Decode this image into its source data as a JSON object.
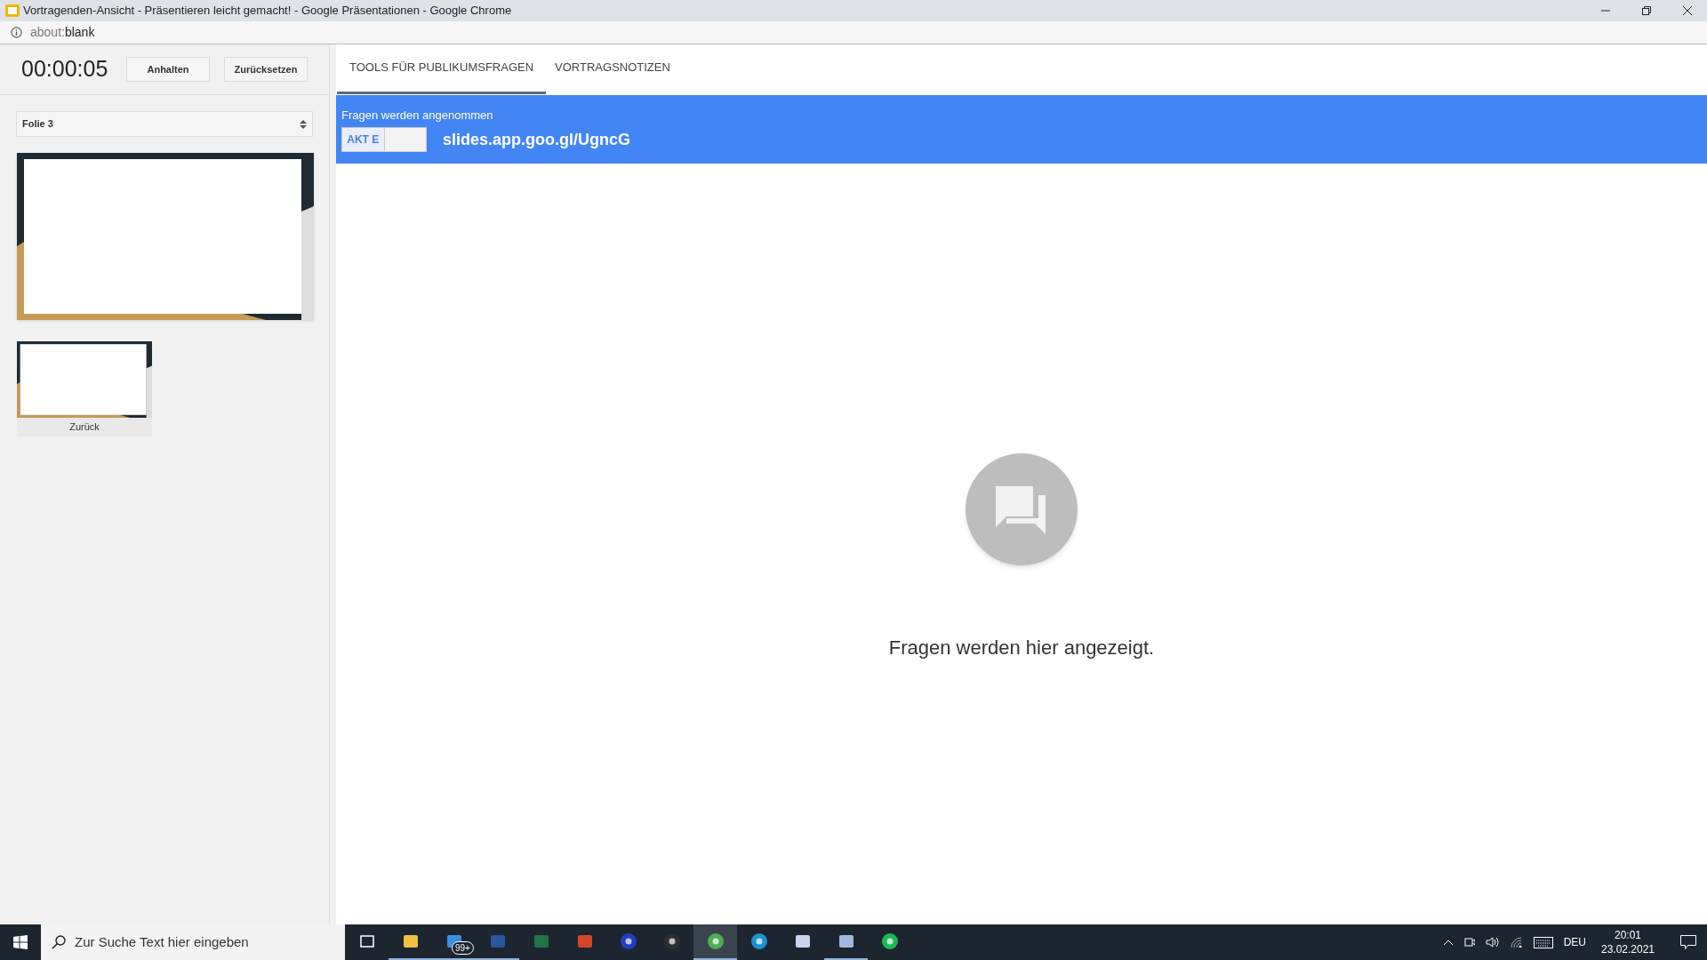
{
  "window": {
    "title": "Vortragenden-Ansicht - Präsentieren leicht gemacht! - Google Präsentationen - Google Chrome"
  },
  "address_bar": {
    "url_prefix": "about:",
    "url_rest": "blank"
  },
  "timer": {
    "time": "00:00:05",
    "buttons": [
      "Anhalten",
      "Zurücksetzen"
    ]
  },
  "slide_select": {
    "value": "Folie 3"
  },
  "slides": [
    {
      "kind": "current"
    },
    {
      "kind": "previous",
      "label": "Zurück"
    }
  ],
  "tabs": [
    {
      "label": "TOOLS FÜR PUBLIKUMSFRAGEN",
      "selected": true
    },
    {
      "label": "VORTRAGSNOTIZEN",
      "selected": false
    }
  ],
  "questions_bar": {
    "status": "Fragen werden angenommen",
    "toggle": {
      "label": "AKT E",
      "on": true
    },
    "link": "slides.app.goo.gl/UgncG"
  },
  "empty_state": {
    "message": "Fragen werden hier angezeigt."
  },
  "taskbar": {
    "search_placeholder": "Zur Suche Text hier eingeben",
    "apps": [
      {
        "kind": "taskview",
        "active": false
      },
      {
        "kind": "folder",
        "active": true
      },
      {
        "kind": "mail",
        "badge": "99+",
        "active": true
      },
      {
        "kind": "word",
        "active": true
      },
      {
        "kind": "excel",
        "active": false
      },
      {
        "kind": "powerpoint",
        "active": false
      },
      {
        "kind": "headphones",
        "active": false
      },
      {
        "kind": "obs",
        "active": false
      },
      {
        "kind": "chrome",
        "active": true
      },
      {
        "kind": "edge",
        "active": false
      },
      {
        "kind": "tool",
        "active": false
      },
      {
        "kind": "notepad",
        "active": true
      },
      {
        "kind": "spotify",
        "active": false
      }
    ],
    "language": "DEU",
    "time": "20:01",
    "date": "23.02.2021"
  }
}
